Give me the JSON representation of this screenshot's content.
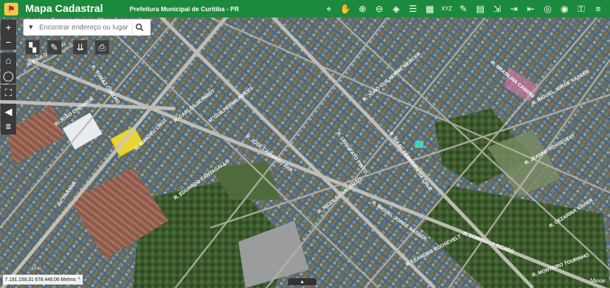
{
  "header": {
    "app_title": "Mapa Cadastral",
    "subtitle": "Prefeitura Municipal de Curitiba - PR"
  },
  "toolbar": {
    "tools": [
      "pin-list-icon",
      "pan-hand-icon",
      "zoom-in-icon",
      "zoom-out-icon",
      "layers-icon",
      "list-icon",
      "grid-icon",
      "xyz-icon",
      "graduation-cap-icon",
      "clipboard-icon",
      "export-icon",
      "login-icon",
      "logout-icon",
      "target-icon",
      "globe-icon",
      "ssl-icon",
      "menu-icon"
    ]
  },
  "search": {
    "placeholder": "Encontrar endereço ou lugar"
  },
  "status": {
    "coordinates": "7.191.158,31 678.446,06 Metros",
    "attribution": "Maxar",
    "scale": "10 m"
  },
  "streets": [
    "R. PAULO GORSKI",
    "R. JOÃO CHEGRUR",
    "R. TOMAZ COELHO",
    "R. JOÃO GUILHERME MERCER",
    "R. GUILHERME INHOFF",
    "R. JOSÉ CAMARGO PAR",
    "R. LISSUFATO PINTO",
    "R. MIGUEL JORGE NASSER",
    "R. EDUARDO CANTAGALLO",
    "R. CARLOS SCHMIDT",
    "AV. PARANÁ",
    "R. ISAAC FERREIRA DA CRUZ",
    "R. NICOLAU SALOMÃO",
    "R. DOMINGOS PICADO",
    "R. LEANDRO ROOSEVELT",
    "R. JEANNE ROSSEVELT",
    "R. CEZARINA XAVIER",
    "R. MONTEIRO TOURINHO",
    "R. BRASILINA CABRINI",
    "R. MIGUEL JORGE NASSER",
    "R. AMADEU CRUZ"
  ],
  "colors": {
    "header": "#1c8a3c",
    "parcel": "#2c5fd6",
    "highlight_yellow": "#e8d53a",
    "highlight_pink": "#d77aa8"
  }
}
